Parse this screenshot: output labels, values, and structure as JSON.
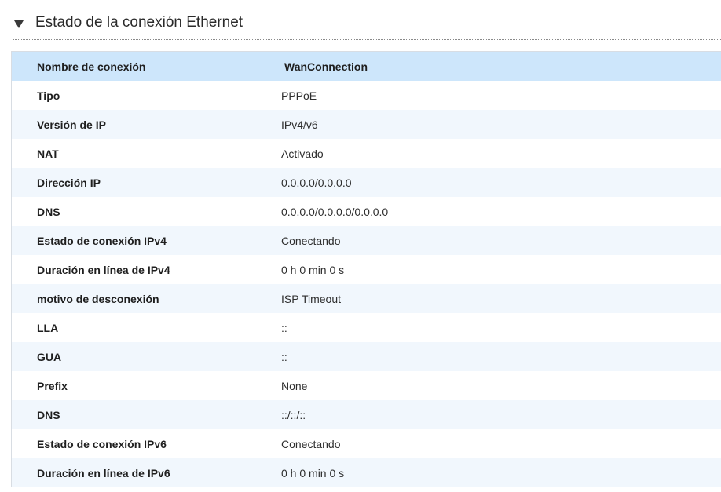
{
  "section": {
    "title": "Estado de la conexión Ethernet"
  },
  "table": {
    "header": {
      "label": "Nombre de conexión",
      "value": "WanConnection"
    },
    "rows": [
      {
        "label": "Tipo",
        "value": "PPPoE"
      },
      {
        "label": "Versión de IP",
        "value": "IPv4/v6"
      },
      {
        "label": "NAT",
        "value": "Activado"
      },
      {
        "label": "Dirección IP",
        "value": "0.0.0.0/0.0.0.0"
      },
      {
        "label": "DNS",
        "value": "0.0.0.0/0.0.0.0/0.0.0.0"
      },
      {
        "label": "Estado de conexión IPv4",
        "value": "Conectando"
      },
      {
        "label": "Duración en línea de IPv4",
        "value": "0 h 0 min 0 s"
      },
      {
        "label": "motivo de desconexión",
        "value": "ISP Timeout"
      },
      {
        "label": "LLA",
        "value": "::"
      },
      {
        "label": "GUA",
        "value": "::"
      },
      {
        "label": "Prefix",
        "value": "None"
      },
      {
        "label": "DNS",
        "value": "::/::/::"
      },
      {
        "label": "Estado de conexión IPv6",
        "value": "Conectando"
      },
      {
        "label": "Duración en línea de IPv6",
        "value": "0 h 0 min 0 s"
      }
    ]
  },
  "colors": {
    "header_row": "#cde6fb",
    "alt_row": "#f1f7fd"
  }
}
